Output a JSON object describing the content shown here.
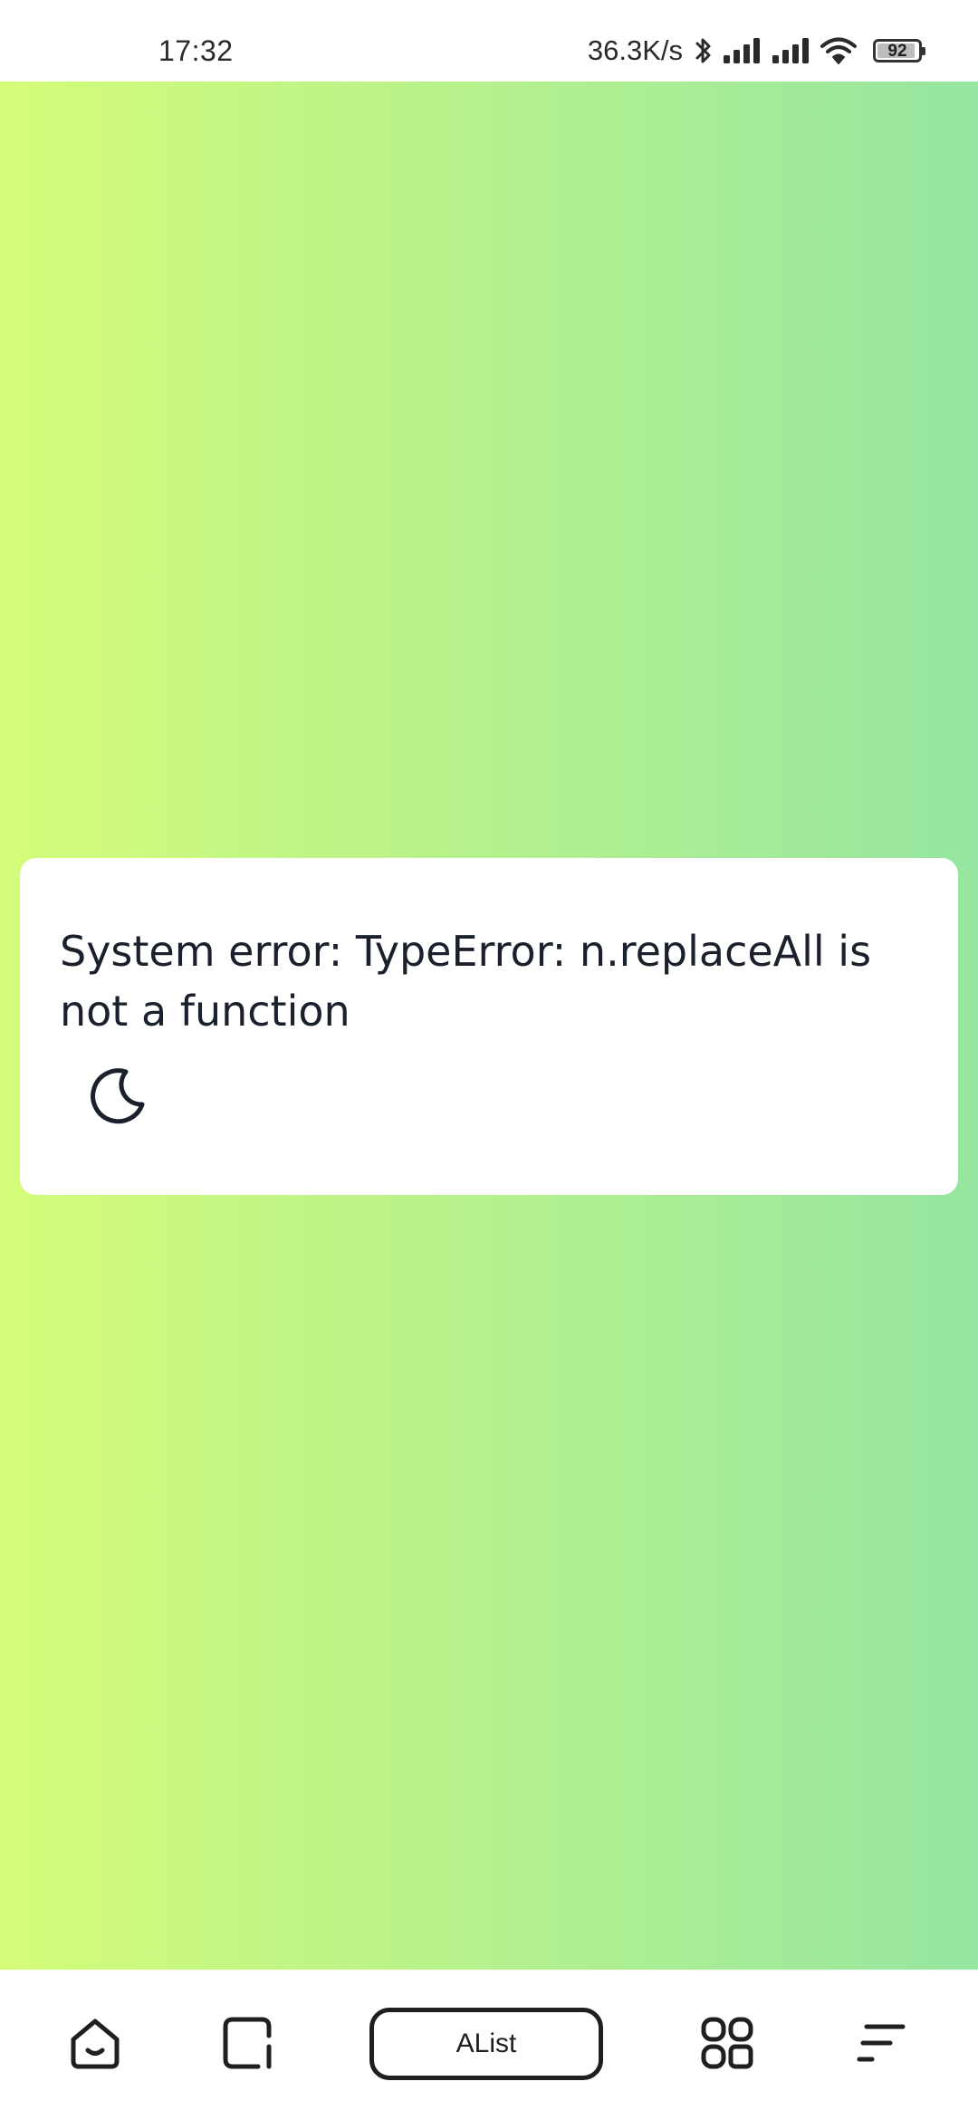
{
  "status_bar": {
    "time": "17:32",
    "network_speed": "36.3K/s",
    "battery_level": "92",
    "icons": [
      "bluetooth-icon",
      "signal-icon",
      "signal-icon",
      "wifi-icon",
      "battery-icon"
    ]
  },
  "background": {
    "gradient_start": "#d4fc79",
    "gradient_end": "#96e6a1"
  },
  "error_card": {
    "message": "System error: TypeError: n.replaceAll is not a function",
    "theme_icon": "moon-icon"
  },
  "bottom_nav": {
    "home_icon": "home-icon",
    "tabs_icon": "tabs-icon",
    "title_label": "AList",
    "apps_icon": "apps-grid-icon",
    "menu_icon": "menu-icon"
  }
}
